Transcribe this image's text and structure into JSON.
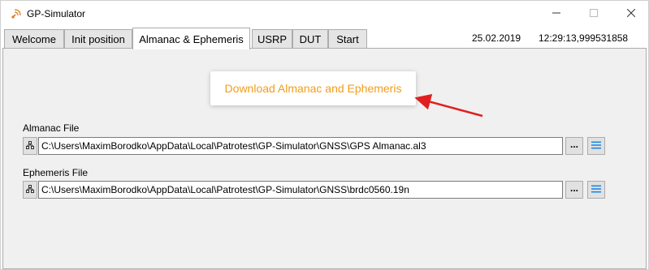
{
  "window": {
    "title": "GP-Simulator",
    "icon": "satellite-dish-icon",
    "controls": {
      "minimize": "minimize-icon",
      "maximize": "maximize-icon",
      "close": "close-icon"
    }
  },
  "tabs": [
    {
      "label": "Welcome",
      "active": false
    },
    {
      "label": "Init position",
      "active": false
    },
    {
      "label": "Almanac & Ephemeris",
      "active": true
    },
    {
      "label": "USRP",
      "active": false
    },
    {
      "label": "DUT",
      "active": false
    },
    {
      "label": "Start",
      "active": false
    }
  ],
  "status": {
    "date": "25.02.2019",
    "time": "12:29:13,999531858"
  },
  "main": {
    "download_button": "Download Almanac and Ephemeris",
    "almanac": {
      "label": "Almanac File",
      "path": "C:\\Users\\MaximBorodko\\AppData\\Local\\Patrotest\\GP-Simulator\\GNSS\\GPS Almanac.al3",
      "browse_label": "..."
    },
    "ephemeris": {
      "label": "Ephemeris File",
      "path": "C:\\Users\\MaximBorodko\\AppData\\Local\\Patrotest\\GP-Simulator\\GNSS\\brdc0560.19n",
      "browse_label": "..."
    }
  },
  "colors": {
    "accent_orange": "#f39c1a",
    "arrow_red": "#e02020",
    "menu_icon_blue": "#1e88e5"
  }
}
